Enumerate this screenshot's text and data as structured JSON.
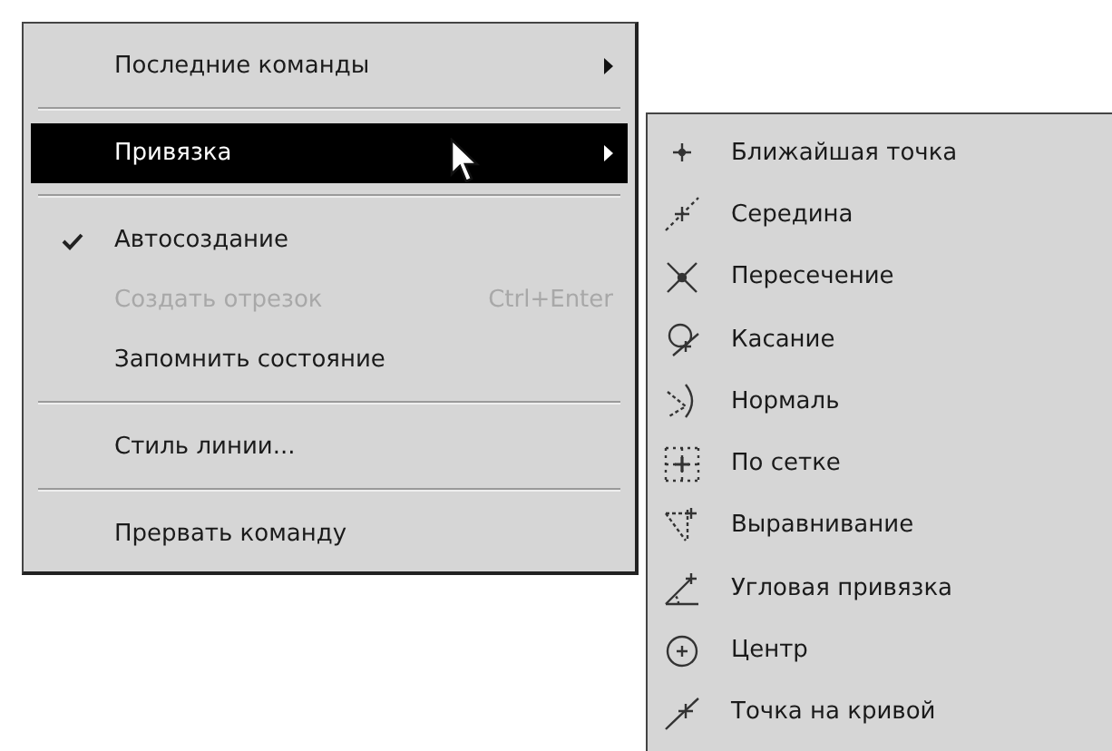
{
  "menu": {
    "items": [
      {
        "kind": "command",
        "label": "Последние команды",
        "submenu": true,
        "selected": false,
        "checked": false,
        "disabled": false
      },
      {
        "kind": "separator"
      },
      {
        "kind": "command",
        "label": "Привязка",
        "submenu": true,
        "selected": true,
        "checked": false,
        "disabled": false
      },
      {
        "kind": "separator"
      },
      {
        "kind": "command",
        "label": "Автосоздание",
        "submenu": false,
        "selected": false,
        "checked": true,
        "disabled": false
      },
      {
        "kind": "command",
        "label": "Создать отрезок",
        "shortcut": "Ctrl+Enter",
        "submenu": false,
        "selected": false,
        "checked": false,
        "disabled": true
      },
      {
        "kind": "command",
        "label": "Запомнить состояние",
        "submenu": false,
        "selected": false,
        "checked": false,
        "disabled": false
      },
      {
        "kind": "separator"
      },
      {
        "kind": "command",
        "label": "Стиль линии...",
        "submenu": false,
        "selected": false,
        "checked": false,
        "disabled": false
      },
      {
        "kind": "separator"
      },
      {
        "kind": "command",
        "label": "Прервать команду",
        "submenu": false,
        "selected": false,
        "checked": false,
        "disabled": false
      }
    ]
  },
  "submenu": {
    "items": [
      {
        "label": "Ближайшая точка"
      },
      {
        "label": "Середина"
      },
      {
        "label": "Пересечение"
      },
      {
        "label": "Касание"
      },
      {
        "label": "Нормаль"
      },
      {
        "label": "По сетке"
      },
      {
        "label": "Выравнивание"
      },
      {
        "label": "Угловая привязка"
      },
      {
        "label": "Центр"
      },
      {
        "label": "Точка на кривой"
      }
    ]
  }
}
